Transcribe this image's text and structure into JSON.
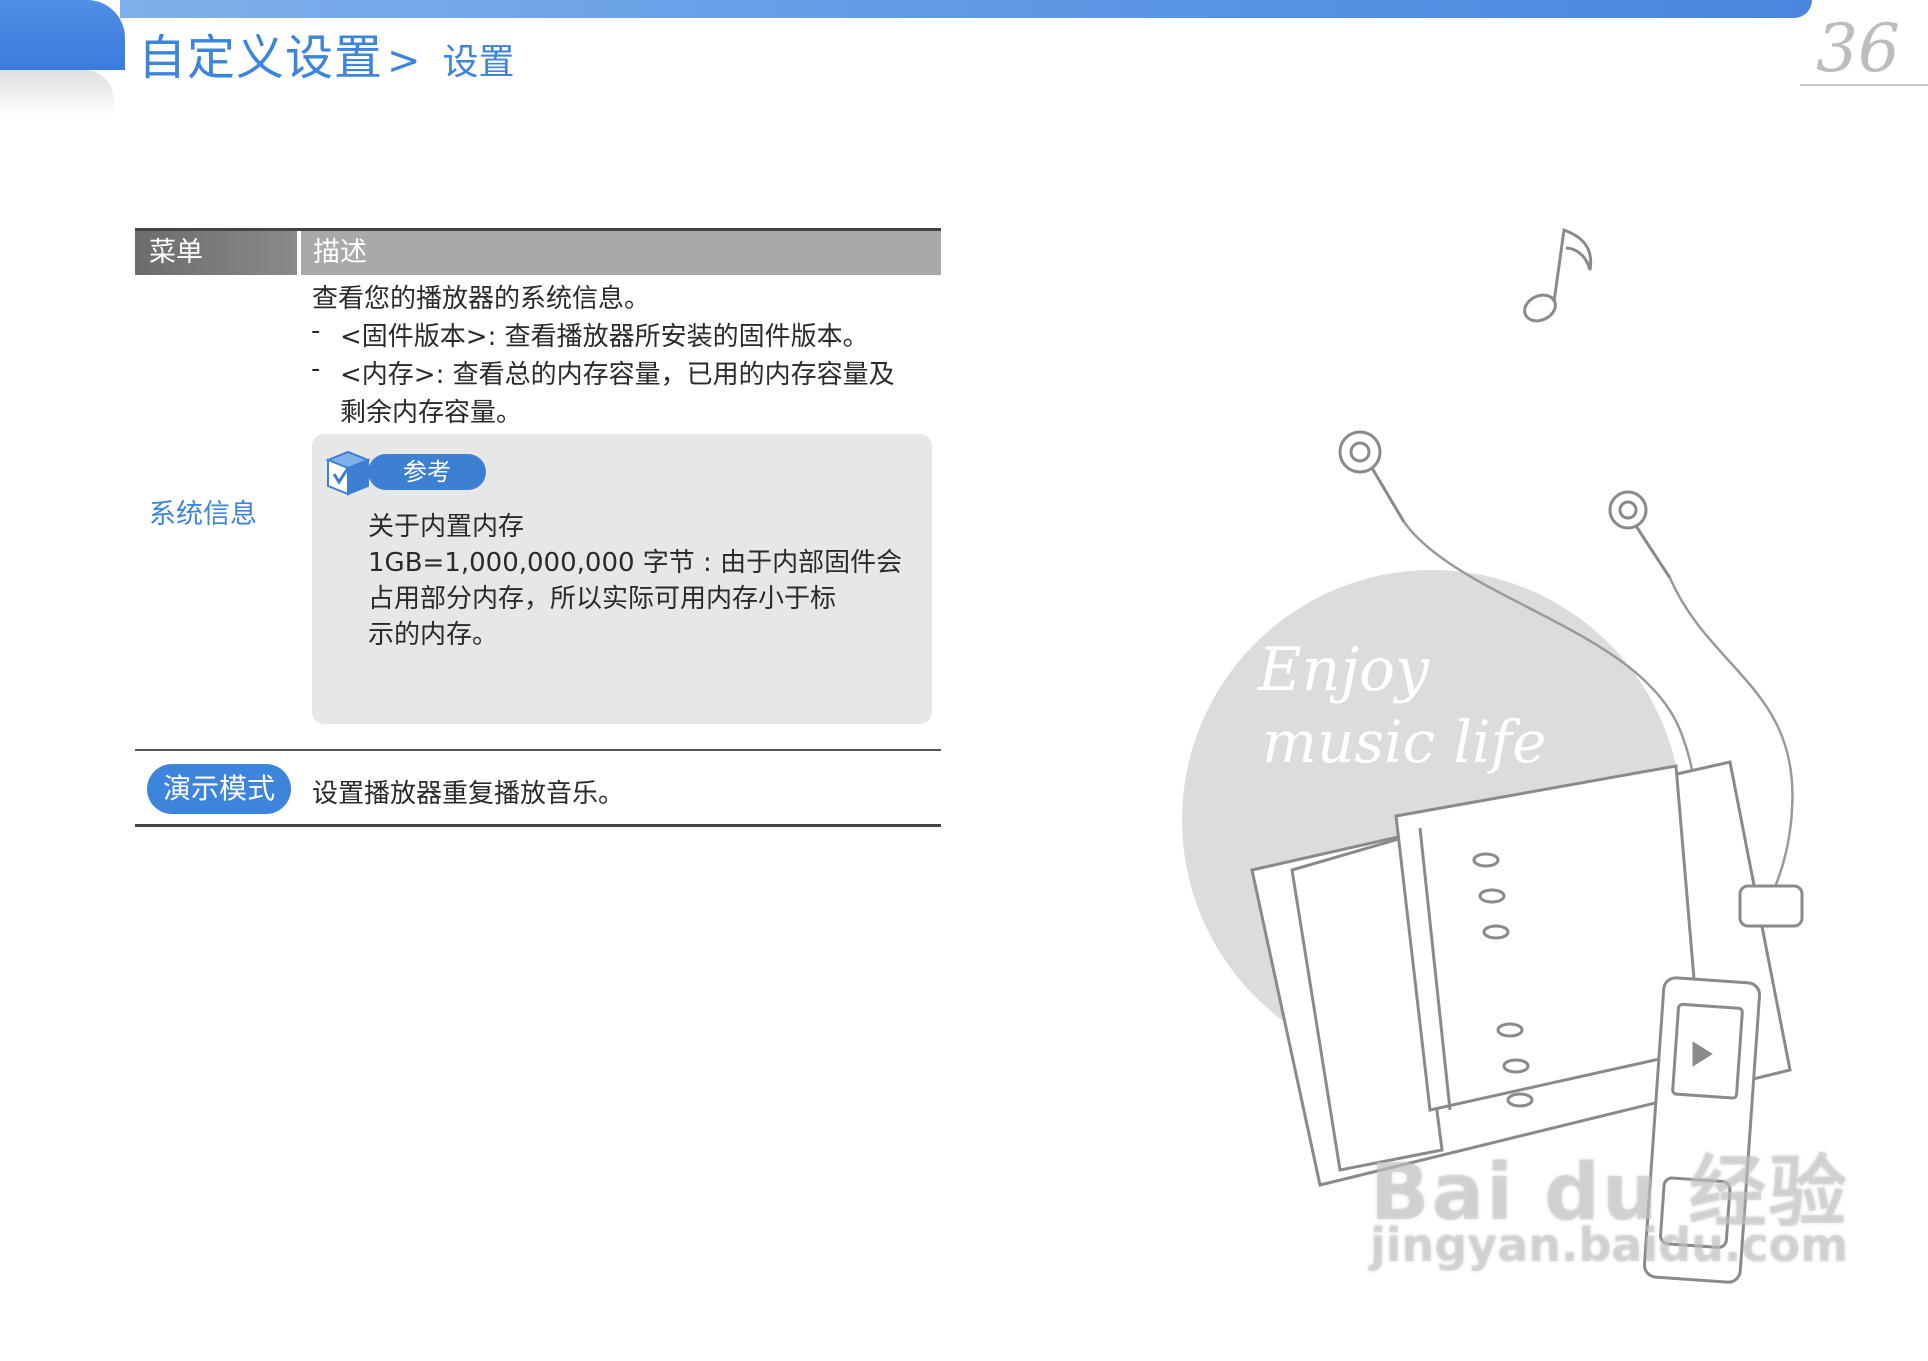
{
  "header": {
    "title": "自定义设置",
    "separator": ">",
    "subtitle": "设置",
    "page_number": "36"
  },
  "table": {
    "head_menu": "菜单",
    "head_desc": "描述",
    "rows": [
      {
        "menu": "系统信息",
        "desc_intro": "查看您的播放器的系统信息。",
        "bullets": [
          {
            "dash": "-",
            "line1": "<固件版本>: 查看播放器所安装的固件版本。",
            "line2": ""
          },
          {
            "dash": "-",
            "line1": "<内存>: 查看总的内存容量，已用的内存容量及",
            "line2": "剩余内存容量。"
          }
        ],
        "note": {
          "badge": "参考",
          "title": "关于内置内存",
          "lines": [
            "1GB=1,000,000,000 字节 : 由于内部固件会",
            "占用部分内存，所以实际可用内存小于标",
            "示的内存。"
          ]
        }
      },
      {
        "menu": "演示模式",
        "desc_intro": "设置播放器重复播放音乐。"
      }
    ]
  },
  "illustration": {
    "slogan_line1": "Enjoy",
    "slogan_line2": "music life",
    "watermark_logo": "Bai du 经验",
    "watermark_url": "jingyan.baidu.com"
  },
  "colors": {
    "accent_blue": "#3d84dc",
    "header_gray": "#a9a9a9",
    "note_bg": "#e7e7e7",
    "circle_gray": "#dcdcdc"
  }
}
